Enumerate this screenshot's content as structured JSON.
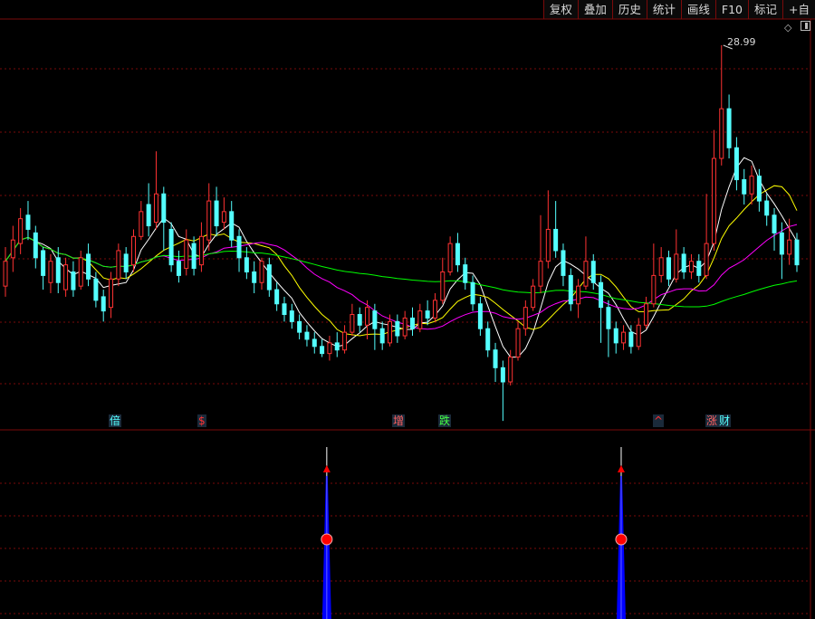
{
  "toolbar": {
    "buttons": [
      "复权",
      "叠加",
      "历史",
      "统计",
      "画线",
      "F10",
      "标记",
      "+自"
    ]
  },
  "colors": {
    "up": "#ff3232",
    "down": "#54ffff",
    "ma5": "#ffffff",
    "ma10": "#ffff00",
    "ma20": "#ff00ff",
    "ma60": "#00ff00",
    "grid": "#7a0a0a",
    "bar": "#0000ff",
    "marker": "#ff0000"
  },
  "icons": {
    "diamond": "diamond-icon",
    "panel": "panel-toggle-icon"
  },
  "chart_data": {
    "type": "candlestick",
    "high_label": "28.99",
    "y_range": [
      19.5,
      29.5
    ],
    "candles": [
      {
        "o": 22.2,
        "c": 22.9,
        "h": 23.3,
        "l": 21.9
      },
      {
        "o": 23.0,
        "c": 23.5,
        "h": 23.9,
        "l": 22.6
      },
      {
        "o": 23.4,
        "c": 24.1,
        "h": 24.4,
        "l": 23.1
      },
      {
        "o": 24.2,
        "c": 23.8,
        "h": 24.6,
        "l": 23.5
      },
      {
        "o": 23.7,
        "c": 23.0,
        "h": 23.9,
        "l": 22.7
      },
      {
        "o": 23.2,
        "c": 22.5,
        "h": 23.3,
        "l": 22.1
      },
      {
        "o": 22.3,
        "c": 22.9,
        "h": 23.1,
        "l": 22.0
      },
      {
        "o": 23.0,
        "c": 22.3,
        "h": 23.3,
        "l": 22.0
      },
      {
        "o": 22.1,
        "c": 22.8,
        "h": 23.0,
        "l": 21.9
      },
      {
        "o": 22.6,
        "c": 22.1,
        "h": 22.9,
        "l": 21.9
      },
      {
        "o": 22.2,
        "c": 23.0,
        "h": 23.2,
        "l": 22.1
      },
      {
        "o": 23.1,
        "c": 22.4,
        "h": 23.4,
        "l": 22.2
      },
      {
        "o": 22.4,
        "c": 21.8,
        "h": 22.6,
        "l": 21.6
      },
      {
        "o": 21.9,
        "c": 21.5,
        "h": 22.1,
        "l": 21.2
      },
      {
        "o": 21.6,
        "c": 22.4,
        "h": 22.6,
        "l": 21.3
      },
      {
        "o": 22.4,
        "c": 23.2,
        "h": 23.4,
        "l": 22.2
      },
      {
        "o": 23.1,
        "c": 22.6,
        "h": 23.3,
        "l": 22.4
      },
      {
        "o": 22.8,
        "c": 23.6,
        "h": 23.8,
        "l": 22.6
      },
      {
        "o": 23.6,
        "c": 24.3,
        "h": 24.6,
        "l": 23.5
      },
      {
        "o": 24.5,
        "c": 23.9,
        "h": 25.1,
        "l": 23.6
      },
      {
        "o": 24.0,
        "c": 24.8,
        "h": 26.0,
        "l": 23.8
      },
      {
        "o": 24.8,
        "c": 24.0,
        "h": 25.0,
        "l": 23.2
      },
      {
        "o": 23.8,
        "c": 22.8,
        "h": 24.0,
        "l": 22.6
      },
      {
        "o": 22.9,
        "c": 22.5,
        "h": 23.2,
        "l": 22.3
      },
      {
        "o": 22.7,
        "c": 23.5,
        "h": 23.8,
        "l": 22.5
      },
      {
        "o": 23.4,
        "c": 22.7,
        "h": 23.6,
        "l": 22.5
      },
      {
        "o": 22.8,
        "c": 23.6,
        "h": 24.0,
        "l": 22.6
      },
      {
        "o": 23.5,
        "c": 24.6,
        "h": 25.1,
        "l": 23.2
      },
      {
        "o": 24.6,
        "c": 23.9,
        "h": 25.0,
        "l": 23.6
      },
      {
        "o": 24.0,
        "c": 24.3,
        "h": 24.7,
        "l": 23.8
      },
      {
        "o": 24.3,
        "c": 23.5,
        "h": 24.6,
        "l": 23.3
      },
      {
        "o": 23.6,
        "c": 23.0,
        "h": 23.8,
        "l": 22.6
      },
      {
        "o": 23.0,
        "c": 22.6,
        "h": 23.3,
        "l": 22.4
      },
      {
        "o": 22.6,
        "c": 22.3,
        "h": 22.9,
        "l": 22.0
      },
      {
        "o": 22.3,
        "c": 22.9,
        "h": 23.0,
        "l": 22.1
      },
      {
        "o": 22.8,
        "c": 22.1,
        "h": 23.0,
        "l": 21.9
      },
      {
        "o": 22.1,
        "c": 21.7,
        "h": 22.3,
        "l": 21.5
      },
      {
        "o": 21.7,
        "c": 21.4,
        "h": 21.9,
        "l": 21.2
      },
      {
        "o": 21.5,
        "c": 21.2,
        "h": 21.7,
        "l": 21.0
      },
      {
        "o": 21.2,
        "c": 20.9,
        "h": 21.4,
        "l": 20.7
      },
      {
        "o": 20.9,
        "c": 20.7,
        "h": 21.1,
        "l": 20.5
      },
      {
        "o": 20.7,
        "c": 20.5,
        "h": 20.9,
        "l": 20.3
      },
      {
        "o": 20.5,
        "c": 20.3,
        "h": 20.7,
        "l": 20.2
      },
      {
        "o": 20.3,
        "c": 20.6,
        "h": 20.8,
        "l": 20.1
      },
      {
        "o": 20.6,
        "c": 20.4,
        "h": 20.9,
        "l": 20.2
      },
      {
        "o": 20.4,
        "c": 20.9,
        "h": 21.1,
        "l": 20.3
      },
      {
        "o": 20.9,
        "c": 21.4,
        "h": 21.7,
        "l": 20.8
      },
      {
        "o": 21.4,
        "c": 21.1,
        "h": 21.6,
        "l": 20.9
      },
      {
        "o": 21.1,
        "c": 21.6,
        "h": 21.8,
        "l": 20.7
      },
      {
        "o": 21.5,
        "c": 21.0,
        "h": 21.7,
        "l": 20.4
      },
      {
        "o": 21.0,
        "c": 20.6,
        "h": 21.2,
        "l": 20.4
      },
      {
        "o": 20.6,
        "c": 21.2,
        "h": 21.4,
        "l": 20.5
      },
      {
        "o": 21.2,
        "c": 20.8,
        "h": 21.4,
        "l": 20.6
      },
      {
        "o": 20.8,
        "c": 21.3,
        "h": 21.5,
        "l": 20.7
      },
      {
        "o": 21.3,
        "c": 21.0,
        "h": 21.6,
        "l": 20.8
      },
      {
        "o": 21.0,
        "c": 21.5,
        "h": 21.7,
        "l": 20.9
      },
      {
        "o": 21.5,
        "c": 21.3,
        "h": 21.8,
        "l": 21.1
      },
      {
        "o": 21.3,
        "c": 21.8,
        "h": 22.0,
        "l": 21.2
      },
      {
        "o": 21.8,
        "c": 22.6,
        "h": 23.0,
        "l": 21.7
      },
      {
        "o": 22.6,
        "c": 23.4,
        "h": 23.6,
        "l": 22.5
      },
      {
        "o": 23.4,
        "c": 22.8,
        "h": 23.7,
        "l": 22.6
      },
      {
        "o": 22.8,
        "c": 22.3,
        "h": 23.0,
        "l": 22.1
      },
      {
        "o": 22.3,
        "c": 21.7,
        "h": 22.5,
        "l": 21.5
      },
      {
        "o": 21.7,
        "c": 21.0,
        "h": 21.9,
        "l": 20.8
      },
      {
        "o": 21.0,
        "c": 20.4,
        "h": 21.2,
        "l": 20.2
      },
      {
        "o": 20.4,
        "c": 19.9,
        "h": 20.6,
        "l": 19.5
      },
      {
        "o": 19.9,
        "c": 19.5,
        "h": 20.1,
        "l": 18.4
      },
      {
        "o": 19.5,
        "c": 20.2,
        "h": 20.4,
        "l": 19.4
      },
      {
        "o": 20.2,
        "c": 21.0,
        "h": 21.2,
        "l": 20.1
      },
      {
        "o": 21.0,
        "c": 21.6,
        "h": 21.8,
        "l": 20.8
      },
      {
        "o": 21.6,
        "c": 22.2,
        "h": 22.4,
        "l": 21.5
      },
      {
        "o": 22.2,
        "c": 22.9,
        "h": 24.2,
        "l": 22.0
      },
      {
        "o": 22.9,
        "c": 23.8,
        "h": 24.9,
        "l": 22.7
      },
      {
        "o": 23.8,
        "c": 23.2,
        "h": 24.6,
        "l": 23.0
      },
      {
        "o": 23.2,
        "c": 22.5,
        "h": 23.4,
        "l": 22.2
      },
      {
        "o": 22.5,
        "c": 21.7,
        "h": 22.7,
        "l": 21.5
      },
      {
        "o": 21.7,
        "c": 22.2,
        "h": 22.4,
        "l": 21.3
      },
      {
        "o": 22.2,
        "c": 22.9,
        "h": 23.6,
        "l": 22.1
      },
      {
        "o": 22.9,
        "c": 22.3,
        "h": 23.1,
        "l": 22.1
      },
      {
        "o": 22.3,
        "c": 21.6,
        "h": 22.5,
        "l": 20.6
      },
      {
        "o": 21.6,
        "c": 21.0,
        "h": 21.8,
        "l": 20.2
      },
      {
        "o": 21.0,
        "c": 20.6,
        "h": 21.2,
        "l": 20.3
      },
      {
        "o": 20.6,
        "c": 20.9,
        "h": 21.1,
        "l": 20.4
      },
      {
        "o": 20.9,
        "c": 20.5,
        "h": 21.1,
        "l": 20.3
      },
      {
        "o": 20.5,
        "c": 21.1,
        "h": 21.3,
        "l": 20.4
      },
      {
        "o": 21.1,
        "c": 21.7,
        "h": 21.9,
        "l": 21.0
      },
      {
        "o": 21.7,
        "c": 22.5,
        "h": 23.4,
        "l": 21.6
      },
      {
        "o": 22.5,
        "c": 23.0,
        "h": 23.3,
        "l": 22.3
      },
      {
        "o": 23.0,
        "c": 22.4,
        "h": 23.2,
        "l": 22.2
      },
      {
        "o": 22.4,
        "c": 23.1,
        "h": 23.8,
        "l": 22.3
      },
      {
        "o": 23.1,
        "c": 22.6,
        "h": 23.3,
        "l": 22.4
      },
      {
        "o": 22.6,
        "c": 22.9,
        "h": 23.1,
        "l": 22.4
      },
      {
        "o": 22.9,
        "c": 22.5,
        "h": 23.1,
        "l": 22.3
      },
      {
        "o": 22.5,
        "c": 23.4,
        "h": 24.8,
        "l": 22.4
      },
      {
        "o": 23.4,
        "c": 25.8,
        "h": 26.6,
        "l": 23.2
      },
      {
        "o": 25.8,
        "c": 27.2,
        "h": 28.99,
        "l": 25.6
      },
      {
        "o": 27.2,
        "c": 26.1,
        "h": 27.6,
        "l": 25.8
      },
      {
        "o": 26.1,
        "c": 25.2,
        "h": 26.4,
        "l": 24.9
      },
      {
        "o": 25.2,
        "c": 24.8,
        "h": 25.5,
        "l": 24.5
      },
      {
        "o": 24.8,
        "c": 25.3,
        "h": 25.6,
        "l": 24.5
      },
      {
        "o": 25.3,
        "c": 24.6,
        "h": 25.5,
        "l": 24.3
      },
      {
        "o": 24.6,
        "c": 24.2,
        "h": 24.8,
        "l": 23.9
      },
      {
        "o": 24.2,
        "c": 23.7,
        "h": 24.4,
        "l": 23.2
      },
      {
        "o": 23.7,
        "c": 23.1,
        "h": 24.0,
        "l": 22.4
      },
      {
        "o": 23.1,
        "c": 23.5,
        "h": 24.1,
        "l": 22.8
      },
      {
        "o": 23.5,
        "c": 22.8,
        "h": 23.7,
        "l": 22.6
      }
    ],
    "signals": [
      {
        "text": "偣",
        "color": "#54ffff",
        "x": 120
      },
      {
        "text": "$",
        "color": "#ff3232",
        "x": 218
      },
      {
        "text": "增",
        "color": "#ff6060",
        "x": 433
      },
      {
        "text": "跌",
        "color": "#44ff44",
        "x": 484
      },
      {
        "text": "^",
        "color": "#ff3232",
        "x": 721
      },
      {
        "text": "涨",
        "color": "#ff6060",
        "x": 779
      },
      {
        "text": "财",
        "color": "#54ffff",
        "x": 793
      }
    ],
    "indicator_events": [
      0.406,
      0.778
    ]
  }
}
